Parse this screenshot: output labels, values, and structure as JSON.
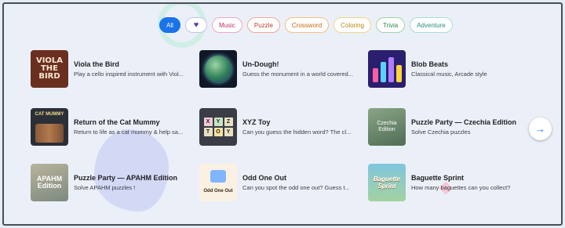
{
  "filters": [
    {
      "key": "all",
      "label": "All",
      "selected": true
    },
    {
      "key": "heart",
      "label": "♥",
      "icon": "heart-icon"
    },
    {
      "key": "music",
      "label": "Music"
    },
    {
      "key": "puzzle",
      "label": "Puzzle"
    },
    {
      "key": "crossword",
      "label": "Crossword"
    },
    {
      "key": "coloring",
      "label": "Coloring"
    },
    {
      "key": "trivia",
      "label": "Trivia"
    },
    {
      "key": "adventure",
      "label": "Adventure"
    }
  ],
  "games": [
    {
      "title": "Viola the Bird",
      "desc": "Play a cello inspired instrument with Viol...",
      "thumb_text": "VIOLA THE BIRD"
    },
    {
      "title": "Un-Dough!",
      "desc": "Guess the monument in a world covered..."
    },
    {
      "title": "Blob Beats",
      "desc": "Classical music, Arcade style"
    },
    {
      "title": "Return of the Cat Mummy",
      "desc": "Return to life as a cat mummy & help sa...",
      "thumb_text": "CAT MUMMY"
    },
    {
      "title": "XYZ Toy",
      "desc": "Can you guess the hidden word? The cl...",
      "thumb_text": [
        "X",
        "Y",
        "Z",
        "T",
        "O",
        "Y"
      ]
    },
    {
      "title": "Puzzle Party — Czechia Edition",
      "desc": "Solve Czechia puzzles",
      "thumb_text": "Czechia Edition"
    },
    {
      "title": "Puzzle Party — APAHM Edition",
      "desc": "Solve APAHM puzzles !",
      "thumb_text": "APAHM Edition"
    },
    {
      "title": "Odd One Out",
      "desc": "Can you spot the odd one out? Guess t...",
      "thumb_text": "Odd One Out"
    },
    {
      "title": "Baguette Sprint",
      "desc": "How many baguettes can you collect?",
      "thumb_text": "Baguette Sprint"
    }
  ],
  "next_button": {
    "icon": "arrow-right-icon",
    "glyph": "→"
  },
  "colors": {
    "accent": "#1a73e8",
    "background": "#ebf0f8"
  }
}
